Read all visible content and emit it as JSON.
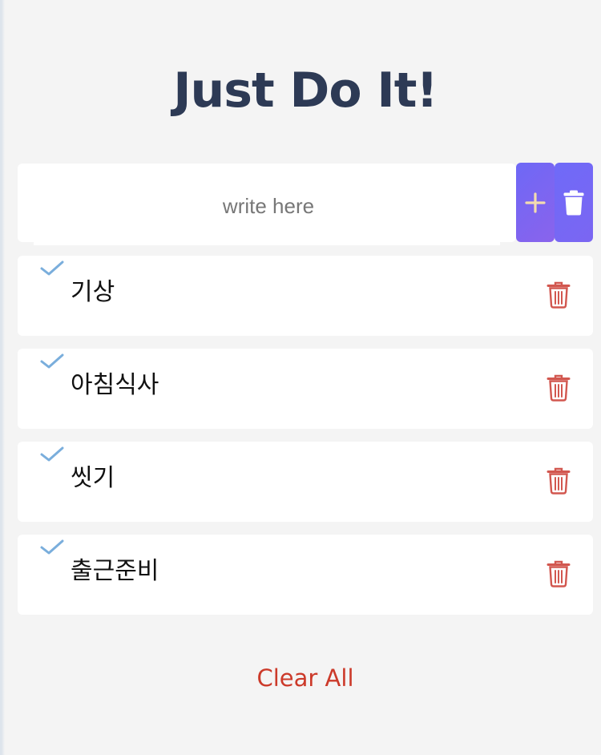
{
  "header": {
    "title": "Just Do It!"
  },
  "input": {
    "placeholder": "write here",
    "value": ""
  },
  "buttons": {
    "add_icon": "plus-icon",
    "delete_icon": "trash-icon",
    "accent_color": "#6e68f6"
  },
  "todos": [
    {
      "text": "기상",
      "done": true
    },
    {
      "text": "아침식사",
      "done": true
    },
    {
      "text": "씻기",
      "done": true
    },
    {
      "text": "출근준비",
      "done": true
    }
  ],
  "icons": {
    "check": "check-icon",
    "remove": "trash-icon",
    "check_color": "#7aaedc",
    "remove_color": "#d2574f"
  },
  "footer": {
    "clear_label": "Clear All",
    "clear_color": "#cc3a2a"
  }
}
